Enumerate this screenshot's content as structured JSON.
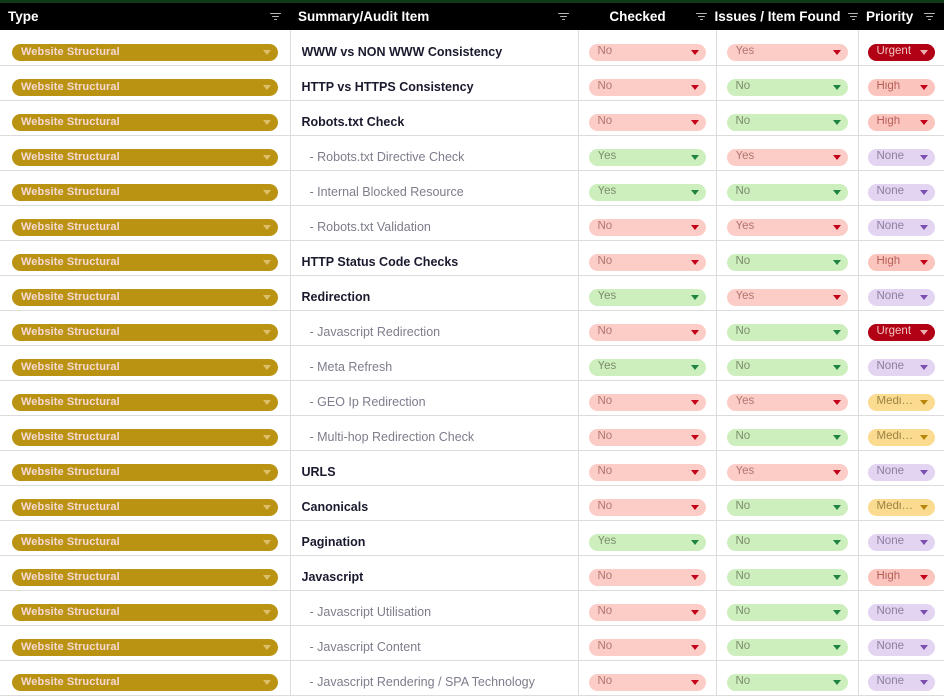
{
  "header": {
    "columns": [
      {
        "label": "Type",
        "align": "left",
        "filter_icon": "filter-funnel-icon"
      },
      {
        "label": "Summary/Audit Item",
        "align": "left",
        "filter_icon": "filter-funnel-icon"
      },
      {
        "label": "Checked",
        "align": "center",
        "filter_icon": "filter-funnel-icon"
      },
      {
        "label": "Issues / Item Found",
        "align": "center",
        "filter_icon": "filter-funnel-icon"
      },
      {
        "label": "Priority",
        "align": "left",
        "filter_icon": "filter-funnel-icon"
      }
    ]
  },
  "colors": {
    "header_bg": "#000000",
    "top_rule": "#0e3a17",
    "type_pill": "#bb9313",
    "good_green": "#cdeebd",
    "bad_red": "#fccdc7",
    "priority_none": "#e3d4f2",
    "priority_high": "#fbc4bd",
    "priority_medium": "#fbdb8f",
    "priority_urgent": "#b20014",
    "grid_line": "#dcdcdc"
  },
  "rows": [
    {
      "type": "Website Structural",
      "summary": "WWW vs NON WWW Consistency",
      "level": "main",
      "checked": "No",
      "issues": "Yes",
      "priority": "Urgent"
    },
    {
      "type": "Website Structural",
      "summary": "HTTP vs HTTPS Consistency",
      "level": "main",
      "checked": "No",
      "issues": "No",
      "priority": "High"
    },
    {
      "type": "Website Structural",
      "summary": "Robots.txt Check",
      "level": "main",
      "checked": "No",
      "issues": "No",
      "priority": "High"
    },
    {
      "type": "Website Structural",
      "summary": "- Robots.txt Directive Check",
      "level": "sub",
      "checked": "Yes",
      "issues": "Yes",
      "priority": "None"
    },
    {
      "type": "Website Structural",
      "summary": "- Internal Blocked Resource",
      "level": "sub",
      "checked": "Yes",
      "issues": "No",
      "priority": "None"
    },
    {
      "type": "Website Structural",
      "summary": "- Robots.txt Validation",
      "level": "sub",
      "checked": "No",
      "issues": "Yes",
      "priority": "None"
    },
    {
      "type": "Website Structural",
      "summary": "HTTP Status Code Checks",
      "level": "main",
      "checked": "No",
      "issues": "No",
      "priority": "High"
    },
    {
      "type": "Website Structural",
      "summary": "Redirection",
      "level": "main",
      "checked": "Yes",
      "issues": "Yes",
      "priority": "None"
    },
    {
      "type": "Website Structural",
      "summary": "- Javascript Redirection",
      "level": "sub",
      "checked": "No",
      "issues": "No",
      "priority": "Urgent"
    },
    {
      "type": "Website Structural",
      "summary": "- Meta Refresh",
      "level": "sub",
      "checked": "Yes",
      "issues": "No",
      "priority": "None"
    },
    {
      "type": "Website Structural",
      "summary": "- GEO Ip Redirection",
      "level": "sub",
      "checked": "No",
      "issues": "Yes",
      "priority": "Medium"
    },
    {
      "type": "Website Structural",
      "summary": "- Multi-hop Redirection Check",
      "level": "sub",
      "checked": "No",
      "issues": "No",
      "priority": "Medium"
    },
    {
      "type": "Website Structural",
      "summary": "URLS",
      "level": "main",
      "checked": "No",
      "issues": "Yes",
      "priority": "None"
    },
    {
      "type": "Website Structural",
      "summary": "Canonicals",
      "level": "main",
      "checked": "No",
      "issues": "No",
      "priority": "Medium"
    },
    {
      "type": "Website Structural",
      "summary": "Pagination",
      "level": "main",
      "checked": "Yes",
      "issues": "No",
      "priority": "None"
    },
    {
      "type": "Website Structural",
      "summary": "Javascript",
      "level": "main",
      "checked": "No",
      "issues": "No",
      "priority": "High"
    },
    {
      "type": "Website Structural",
      "summary": "- Javascript Utilisation",
      "level": "sub",
      "checked": "No",
      "issues": "No",
      "priority": "None"
    },
    {
      "type": "Website Structural",
      "summary": "- Javascript Content",
      "level": "sub",
      "checked": "No",
      "issues": "No",
      "priority": "None"
    },
    {
      "type": "Website Structural",
      "summary": "- Javascript Rendering / SPA Technology",
      "level": "sub",
      "checked": "No",
      "issues": "No",
      "priority": "None"
    }
  ]
}
